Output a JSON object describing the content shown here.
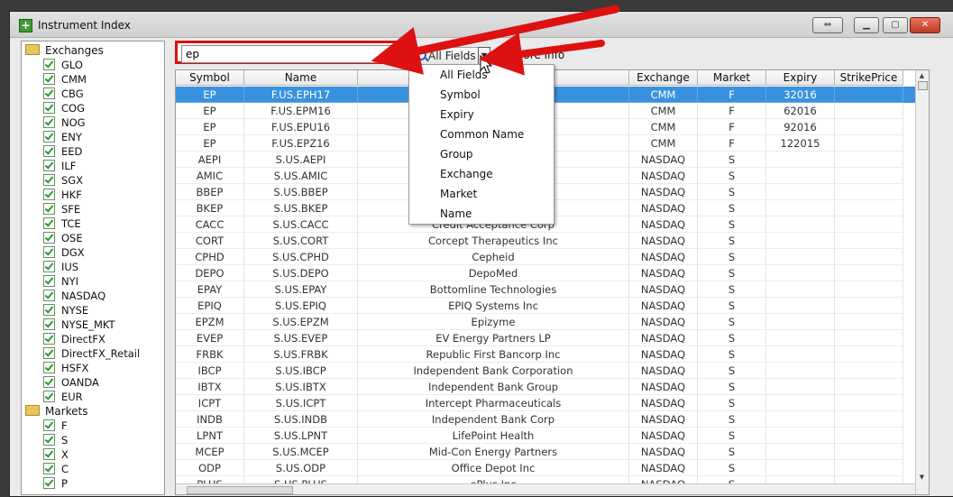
{
  "window": {
    "title": "Instrument Index",
    "app_icon": "plus-icon",
    "controls": [
      "restore-icon",
      "minimize-icon",
      "maximize-icon",
      "close-icon"
    ]
  },
  "tree": {
    "exchanges_label": "Exchanges",
    "exchanges": [
      "GLO",
      "CMM",
      "CBG",
      "COG",
      "NOG",
      "ENY",
      "EED",
      "ILF",
      "SGX",
      "HKF",
      "SFE",
      "TCE",
      "OSE",
      "DGX",
      "IUS",
      "NYI",
      "NASDAQ",
      "NYSE",
      "NYSE_MKT",
      "DirectFX",
      "DirectFX_Retail",
      "HSFX",
      "OANDA",
      "EUR"
    ],
    "markets_label": "Markets",
    "markets": [
      "F",
      "S",
      "X",
      "C",
      "P"
    ]
  },
  "search": {
    "value": "ep"
  },
  "field_combo": {
    "label": "All Fields",
    "icon": "search-icon"
  },
  "more_info": {
    "label": "More Info",
    "icon": "info-icon"
  },
  "dropdown": {
    "items": [
      "All Fields",
      "Symbol",
      "Expiry",
      "Common Name",
      "Group",
      "Exchange",
      "Market",
      "Name"
    ]
  },
  "table": {
    "columns": [
      "Symbol",
      "Name",
      "",
      "Exchange",
      "Market",
      "Expiry",
      "StrikePrice"
    ],
    "selected_row": 0,
    "rows": [
      [
        "EP",
        "F.US.EPH17",
        "",
        "CMM",
        "F",
        "32016",
        ""
      ],
      [
        "EP",
        "F.US.EPM16",
        "",
        "CMM",
        "F",
        "62016",
        ""
      ],
      [
        "EP",
        "F.US.EPU16",
        "",
        "CMM",
        "F",
        "92016",
        ""
      ],
      [
        "EP",
        "F.US.EPZ16",
        "",
        "CMM",
        "F",
        "122015",
        ""
      ],
      [
        "AEPI",
        "S.US.AEPI",
        "",
        "NASDAQ",
        "S",
        "",
        ""
      ],
      [
        "AMIC",
        "S.US.AMIC",
        "Am           oration",
        "NASDAQ",
        "S",
        "",
        ""
      ],
      [
        "BBEP",
        "S.US.BBEP",
        "rs",
        "NASDAQ",
        "S",
        "",
        ""
      ],
      [
        "BKEP",
        "S.US.BKEP",
        "L.P.",
        "NASDAQ",
        "S",
        "",
        ""
      ],
      [
        "CACC",
        "S.US.CACC",
        "Credit Acceptance Corp",
        "NASDAQ",
        "S",
        "",
        ""
      ],
      [
        "CORT",
        "S.US.CORT",
        "Corcept Therapeutics Inc",
        "NASDAQ",
        "S",
        "",
        ""
      ],
      [
        "CPHD",
        "S.US.CPHD",
        "Cepheid",
        "NASDAQ",
        "S",
        "",
        ""
      ],
      [
        "DEPO",
        "S.US.DEPO",
        "DepoMed",
        "NASDAQ",
        "S",
        "",
        ""
      ],
      [
        "EPAY",
        "S.US.EPAY",
        "Bottomline Technologies",
        "NASDAQ",
        "S",
        "",
        ""
      ],
      [
        "EPIQ",
        "S.US.EPIQ",
        "EPIQ Systems Inc",
        "NASDAQ",
        "S",
        "",
        ""
      ],
      [
        "EPZM",
        "S.US.EPZM",
        "Epizyme",
        "NASDAQ",
        "S",
        "",
        ""
      ],
      [
        "EVEP",
        "S.US.EVEP",
        "EV Energy Partners LP",
        "NASDAQ",
        "S",
        "",
        ""
      ],
      [
        "FRBK",
        "S.US.FRBK",
        "Republic First Bancorp Inc",
        "NASDAQ",
        "S",
        "",
        ""
      ],
      [
        "IBCP",
        "S.US.IBCP",
        "Independent Bank Corporation",
        "NASDAQ",
        "S",
        "",
        ""
      ],
      [
        "IBTX",
        "S.US.IBTX",
        "Independent Bank Group",
        "NASDAQ",
        "S",
        "",
        ""
      ],
      [
        "ICPT",
        "S.US.ICPT",
        "Intercept Pharmaceuticals",
        "NASDAQ",
        "S",
        "",
        ""
      ],
      [
        "INDB",
        "S.US.INDB",
        "Independent Bank Corp",
        "NASDAQ",
        "S",
        "",
        ""
      ],
      [
        "LPNT",
        "S.US.LPNT",
        "LifePoint Health",
        "NASDAQ",
        "S",
        "",
        ""
      ],
      [
        "MCEP",
        "S.US.MCEP",
        "Mid-Con Energy Partners",
        "NASDAQ",
        "S",
        "",
        ""
      ],
      [
        "ODP",
        "S.US.ODP",
        "Office Depot Inc",
        "NASDAQ",
        "S",
        "",
        ""
      ],
      [
        "PLUS",
        "S.US.PLUS",
        "ePlus Inc",
        "NASDAQ",
        "S",
        "",
        ""
      ]
    ]
  },
  "colors": {
    "highlight": "#dd1111",
    "selection": "#3a92de"
  }
}
